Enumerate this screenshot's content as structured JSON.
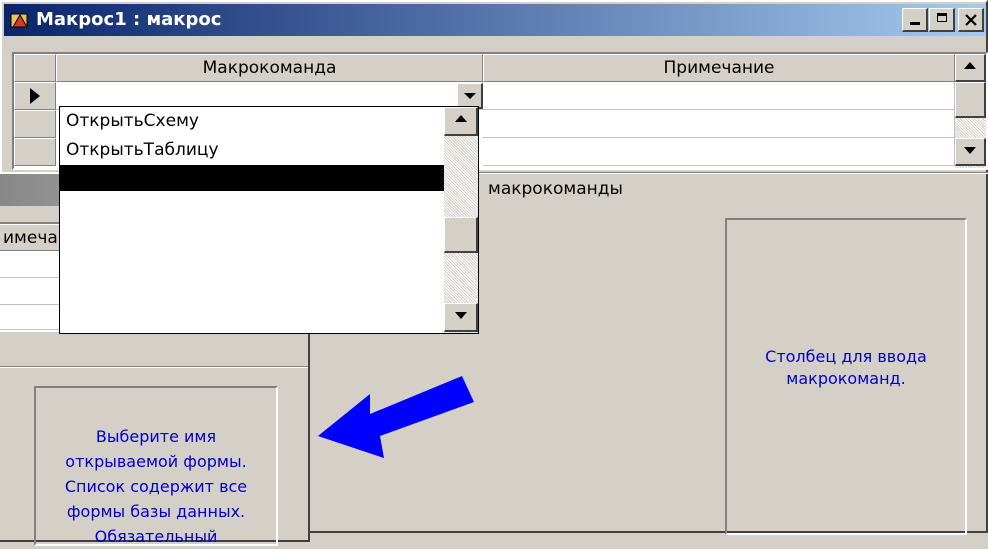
{
  "back_window": {
    "title": "Макрос1 : макрос",
    "columns": {
      "action": "Макрокоманда",
      "comment": "Примечание"
    },
    "section_label_fragment": "макрокоманды",
    "help_text": "Столбец для ввода макрокоманд."
  },
  "dropdown": {
    "items": [
      "ОткрытьСхему",
      "ОткрытьТаблицу",
      ""
    ],
    "selected_index": 2
  },
  "front_window": {
    "column_fragment": "имечание",
    "help_text": "Выберите имя открываемой формы. Список содержит все формы базы данных. Обязательный"
  },
  "icons": {
    "minimize": "minimize-icon",
    "maximize": "maximize-icon",
    "close": "close-icon",
    "row_pointer": "row-pointer-icon",
    "arrow": "blue-arrow-icon"
  },
  "colors": {
    "title_active": "#0a246a",
    "title_gradient_end": "#a6caf0",
    "help_text": "#0000c8",
    "arrow": "#0000ff",
    "window_face": "#d4d0c8"
  }
}
